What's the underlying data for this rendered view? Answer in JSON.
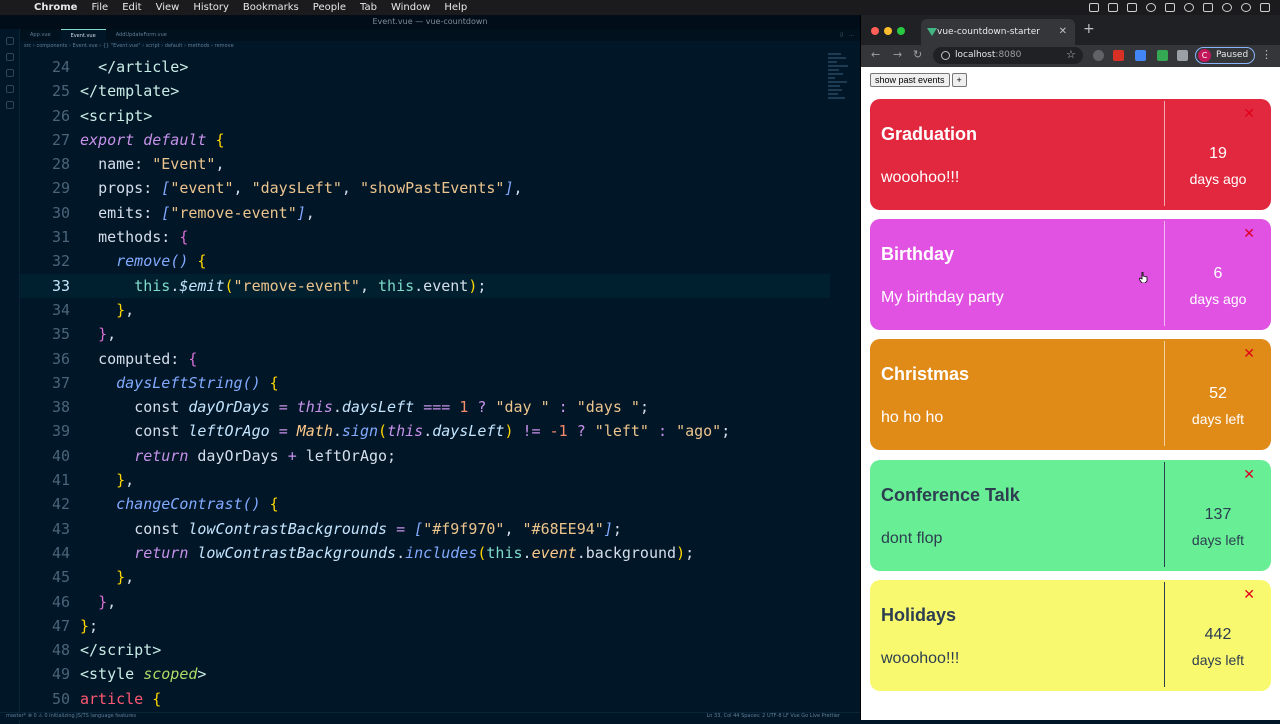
{
  "menubar": {
    "app": "Chrome",
    "items": [
      "File",
      "Edit",
      "View",
      "History",
      "Bookmarks",
      "People",
      "Tab",
      "Window",
      "Help"
    ]
  },
  "editor": {
    "window_title": "Event.vue — vue-countdown",
    "tabs": [
      "App.vue",
      "Event.vue",
      "AddUpdateForm.vue"
    ],
    "breadcrumb": "src › components › Event.vue › {} \"Event.vue\" › script › default › methods › remove",
    "status_left": "master* ⊗ 0 ⚠ 0   Initializing JS/TS language features",
    "status_right": "Ln 33, Col 44   Spaces: 2   UTF-8   LF   Vue   Go Live   Prettier",
    "lines": [
      {
        "n": "24",
        "html": "  <span class='t-tag'>&lt;/article&gt;</span>"
      },
      {
        "n": "25",
        "html": "<span class='t-tag'>&lt;/template&gt;</span>"
      },
      {
        "n": "26",
        "html": "<span class='t-tag'>&lt;script&gt;</span>"
      },
      {
        "n": "27",
        "html": "<span class='t-kw'>export</span> <span class='t-kw'>default</span> <span class='t-br'>{</span>"
      },
      {
        "n": "28",
        "html": "  <span class='t-plain'>name:</span> <span class='t-str'>\"Event\"</span><span class='t-plain'>,</span>"
      },
      {
        "n": "29",
        "html": "  <span class='t-plain'>props:</span> <span class='t-fn'>[</span><span class='t-str'>\"event\"</span><span class='t-plain'>,</span> <span class='t-str'>\"daysLeft\"</span><span class='t-plain'>,</span> <span class='t-str'>\"showPastEvents\"</span><span class='t-fn'>]</span><span class='t-plain'>,</span>"
      },
      {
        "n": "30",
        "html": "  <span class='t-plain'>emits:</span> <span class='t-fn'>[</span><span class='t-str'>\"remove-event\"</span><span class='t-fn'>]</span><span class='t-plain'>,</span>"
      },
      {
        "n": "31",
        "html": "  <span class='t-plain'>methods:</span> <span class='t-gold'>{</span>"
      },
      {
        "n": "32",
        "html": "    <span class='t-fn'>remove</span><span class='t-fn'>()</span> <span class='t-br'>{</span>"
      },
      {
        "n": "33",
        "html": "      <span class='t-this'>this</span><span class='t-plain'>.</span><span class='t-var'>$emit</span><span class='t-br'>(</span><span class='t-str'>\"remove-event\"</span><span class='t-plain'>,</span> <span class='t-this'>this</span><span class='t-plain'>.event</span><span class='t-br'>)</span><span class='t-plain'>;</span>",
        "current": true
      },
      {
        "n": "34",
        "html": "    <span class='t-br'>}</span><span class='t-plain'>,</span>"
      },
      {
        "n": "35",
        "html": "  <span class='t-gold'>}</span><span class='t-plain'>,</span>"
      },
      {
        "n": "36",
        "html": "  <span class='t-plain'>computed:</span> <span class='t-gold'>{</span>"
      },
      {
        "n": "37",
        "html": "    <span class='t-fn'>daysLeftString</span><span class='t-fn'>()</span> <span class='t-br'>{</span>"
      },
      {
        "n": "38",
        "html": "      <span class='t-plain'>const</span> <span class='t-var'>dayOrDays</span> <span class='t-op'>=</span> <span class='t-kw'>this</span><span class='t-plain'>.</span><span class='t-var'>daysLeft</span> <span class='t-op'>===</span> <span class='t-num'>1</span> <span class='t-op'>?</span> <span class='t-str'>\"day \"</span> <span class='t-op'>:</span> <span class='t-str'>\"days \"</span><span class='t-plain'>;</span>"
      },
      {
        "n": "39",
        "html": "      <span class='t-plain'>const</span> <span class='t-var'>leftOrAgo</span> <span class='t-op'>=</span> <span class='t-cls'>Math</span><span class='t-plain'>.</span><span class='t-fn'>sign</span><span class='t-br'>(</span><span class='t-kw'>this</span><span class='t-plain'>.</span><span class='t-var'>daysLeft</span><span class='t-br'>)</span> <span class='t-op'>!=</span> <span class='t-num'>-1</span> <span class='t-op'>?</span> <span class='t-str'>\"left\"</span> <span class='t-op'>:</span> <span class='t-str'>\"ago\"</span><span class='t-plain'>;</span>"
      },
      {
        "n": "40",
        "html": "      <span class='t-kw'>return</span> <span class='t-plain'>dayOrDays</span> <span class='t-op'>+</span> <span class='t-plain'>leftOrAgo;</span>"
      },
      {
        "n": "41",
        "html": "    <span class='t-br'>}</span><span class='t-plain'>,</span>"
      },
      {
        "n": "42",
        "html": "    <span class='t-fn'>changeContrast</span><span class='t-fn'>()</span> <span class='t-br'>{</span>"
      },
      {
        "n": "43",
        "html": "      <span class='t-plain'>const</span> <span class='t-var'>lowContrastBackgrounds</span> <span class='t-op'>=</span> <span class='t-fn'>[</span><span class='t-str'>\"#f9f970\"</span><span class='t-plain'>,</span> <span class='t-str'>\"#68EE94\"</span><span class='t-fn'>]</span><span class='t-plain'>;</span>"
      },
      {
        "n": "44",
        "html": "      <span class='t-kw'>return</span> <span class='t-var'>lowContrastBackgrounds</span><span class='t-plain'>.</span><span class='t-fn'>includes</span><span class='t-br'>(</span><span class='t-this'>this</span><span class='t-plain'>.</span><span class='t-cls'>event</span><span class='t-plain'>.background</span><span class='t-br'>)</span><span class='t-plain'>;</span>"
      },
      {
        "n": "45",
        "html": "    <span class='t-br'>}</span><span class='t-plain'>,</span>"
      },
      {
        "n": "46",
        "html": "  <span class='t-gold'>}</span><span class='t-plain'>,</span>"
      },
      {
        "n": "47",
        "html": "<span class='t-br'>}</span><span class='t-plain'>;</span>"
      },
      {
        "n": "48",
        "html": "<span class='t-tag'>&lt;/script&gt;</span>"
      },
      {
        "n": "49",
        "html": "<span class='t-tag'>&lt;style</span> <span class='t-attr'>scoped</span><span class='t-tag'>&gt;</span>"
      },
      {
        "n": "50",
        "html": "<span class='t-sel'>article</span> <span class='t-br'>{</span>"
      }
    ]
  },
  "browser": {
    "tab_title": "vue-countdown-starter",
    "url_host": "localhost",
    "url_port": ":8080",
    "profile_initial": "C",
    "profile_status": "Paused"
  },
  "app": {
    "show_past_label": "show past events",
    "add_label": "+",
    "remove_label": "✕",
    "events": [
      {
        "title": "Graduation",
        "desc": "wooohoo!!!",
        "days": "19",
        "label": "days ago",
        "color": "#e2283f",
        "theme": "light-text"
      },
      {
        "title": "Birthday",
        "desc": "My birthday party",
        "days": "6",
        "label": "days ago",
        "color": "#e152e3",
        "theme": "light-text"
      },
      {
        "title": "Christmas",
        "desc": "ho ho ho",
        "days": "52",
        "label": "days left",
        "color": "#e08a18",
        "theme": "light-text"
      },
      {
        "title": "Conference Talk",
        "desc": "dont flop",
        "days": "137",
        "label": "days left",
        "color": "#68ee94",
        "theme": "dark-text"
      },
      {
        "title": "Holidays",
        "desc": "wooohoo!!!",
        "days": "442",
        "label": "days left",
        "color": "#f9f970",
        "theme": "dark-text"
      }
    ]
  }
}
